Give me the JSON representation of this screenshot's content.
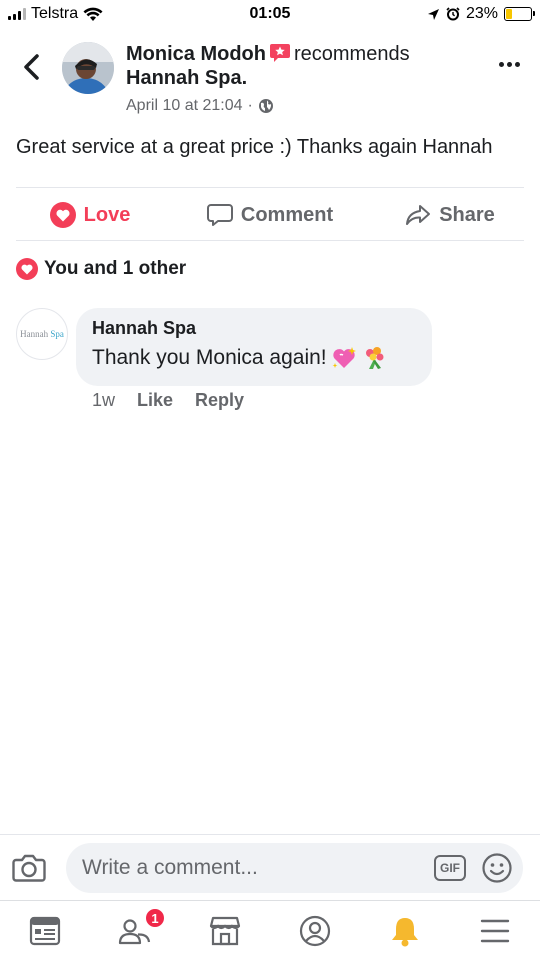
{
  "status_bar": {
    "carrier": "Telstra",
    "time": "01:05",
    "battery": "23%",
    "battery_level": 0.23
  },
  "post": {
    "author": "Monica Modoh",
    "verb": "recommends",
    "page": "Hannah Spa.",
    "timestamp": "April 10 at 21:04",
    "separator": "·",
    "text": "Great service at a great price :) Thanks again Hannah"
  },
  "actions": {
    "love_label": "Love",
    "comment_label": "Comment",
    "share_label": "Share"
  },
  "reactions": {
    "summary": "You and 1 other"
  },
  "comment": {
    "avatar_text": "Hannah",
    "avatar_text_accent": "Spa",
    "author": "Hannah Spa",
    "text": "Thank you Monica again!",
    "age": "1w",
    "like_label": "Like",
    "reply_label": "Reply"
  },
  "composer": {
    "placeholder": "Write a comment...",
    "gif_label": "GIF"
  },
  "tabbar": {
    "friends_badge": "1"
  },
  "colors": {
    "love": "#f33e58",
    "muted": "#65676b",
    "bubble": "#f0f2f5",
    "bell_active": "#f5b82e",
    "battery_fill": "#f7c600"
  }
}
